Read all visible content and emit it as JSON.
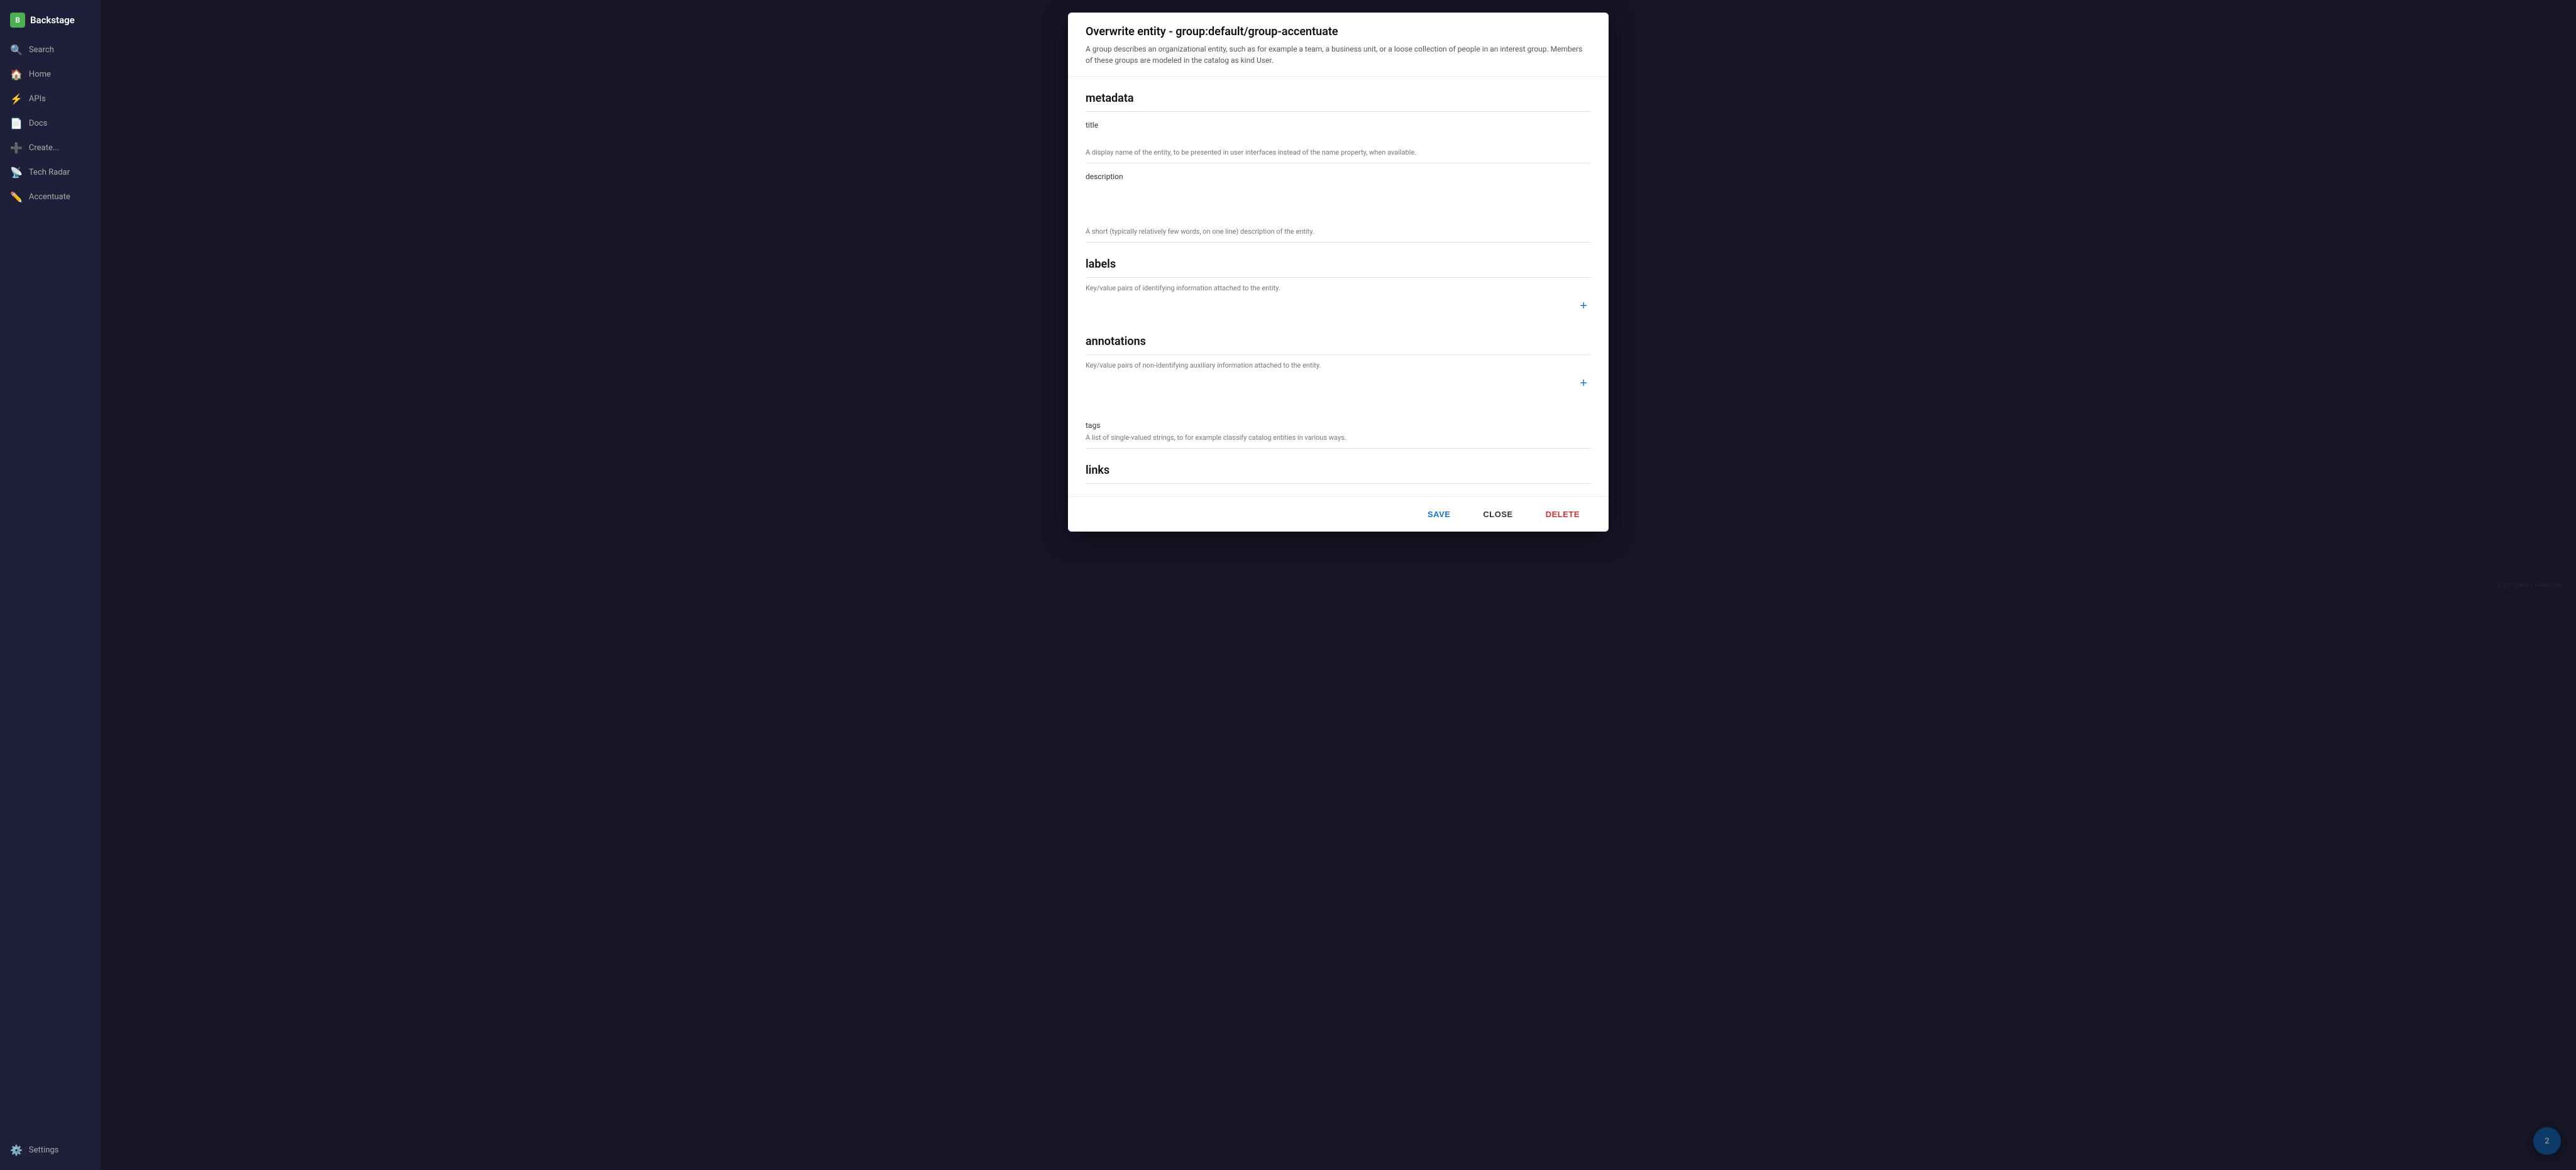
{
  "app": {
    "name": "Backstage"
  },
  "sidebar": {
    "logo_label": "Backstage",
    "items": [
      {
        "id": "search",
        "label": "Search",
        "icon": "🔍"
      },
      {
        "id": "home",
        "label": "Home",
        "icon": "🏠"
      },
      {
        "id": "apis",
        "label": "APIs",
        "icon": "⚡"
      },
      {
        "id": "docs",
        "label": "Docs",
        "icon": "📄"
      },
      {
        "id": "create",
        "label": "Create...",
        "icon": "➕"
      },
      {
        "id": "tech-radar",
        "label": "Tech Radar",
        "icon": "📡"
      },
      {
        "id": "accentuate",
        "label": "Accentuate",
        "icon": "✏️"
      },
      {
        "id": "settings",
        "label": "Settings",
        "icon": "⚙️"
      }
    ]
  },
  "background": {
    "text": "Aggregated Relations"
  },
  "modal": {
    "title": "Overwrite entity - group:default/group-accentuate",
    "subtitle": "A group describes an organizational entity, such as for example a team, a business unit, or a loose collection of people in an interest group. Members of these groups are modeled in the catalog as kind User.",
    "sections": [
      {
        "id": "metadata",
        "title": "metadata",
        "fields": [
          {
            "id": "title",
            "label": "title",
            "value": "",
            "placeholder": "",
            "description": "A display name of the entity, to be presented in user interfaces instead of the name property, when available.",
            "type": "input"
          },
          {
            "id": "description",
            "label": "description",
            "value": "",
            "placeholder": "",
            "description": "A short (typically relatively few words, on one line) description of the entity.",
            "type": "textarea"
          }
        ]
      },
      {
        "id": "labels",
        "title": "labels",
        "description": "Key/value pairs of identifying information attached to the entity.",
        "has_add": true
      },
      {
        "id": "annotations",
        "title": "annotations",
        "description": "Key/value pairs of non-identifying auxiliary information attached to the entity.",
        "has_add": true
      },
      {
        "id": "tags",
        "title": "",
        "fields": [
          {
            "id": "tags",
            "label": "tags",
            "description": "A list of single-valued strings, to for example classify catalog entities in various ways.",
            "type": "input",
            "value": ""
          }
        ]
      },
      {
        "id": "links",
        "title": "links",
        "description": ""
      }
    ],
    "footer": {
      "save_label": "SAVE",
      "close_label": "CLOSE",
      "delete_label": "DELETE"
    }
  },
  "fab": {
    "badge": "2"
  }
}
